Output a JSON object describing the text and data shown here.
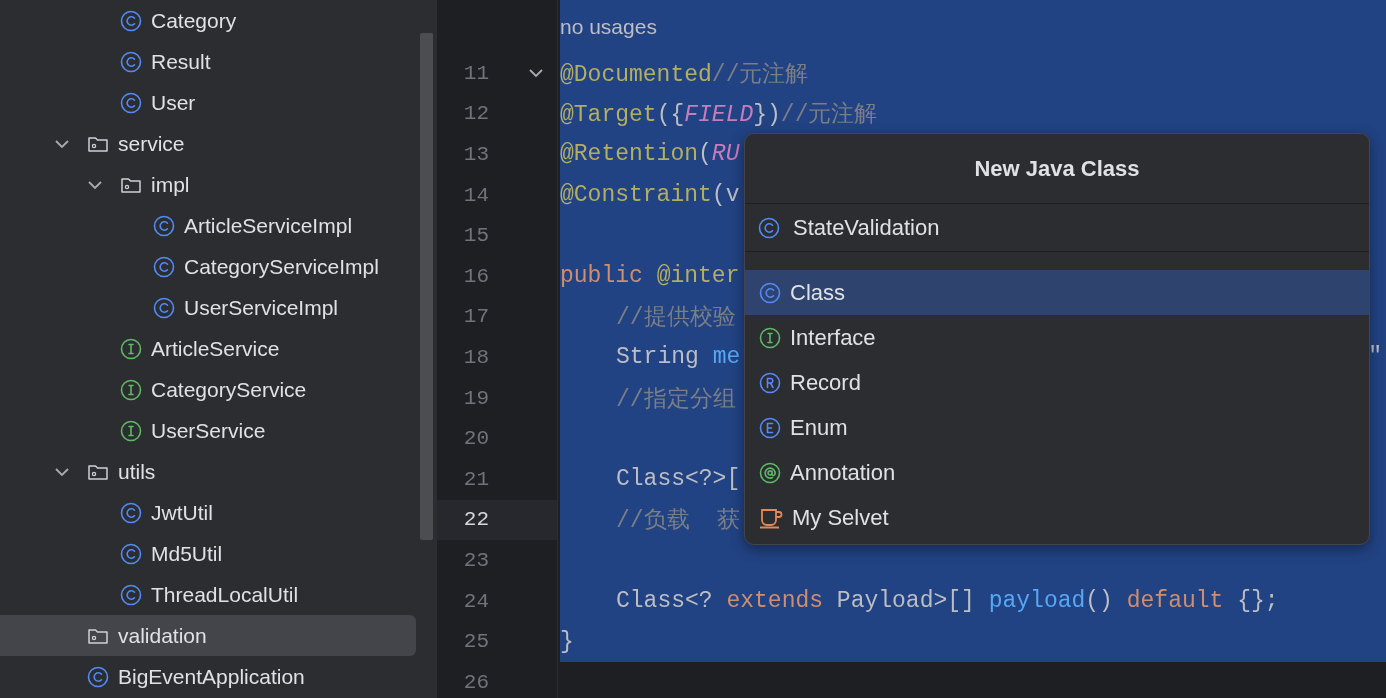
{
  "project_tree": {
    "continued_items": [
      {
        "label": "Category",
        "kind": "class",
        "selected": false
      },
      {
        "label": "Result",
        "kind": "class",
        "selected": false
      },
      {
        "label": "User",
        "kind": "class",
        "selected": false
      }
    ],
    "items": [
      {
        "label": "service",
        "kind": "folder",
        "expanded": true,
        "selected": false,
        "children": [
          {
            "label": "impl",
            "kind": "folder",
            "expanded": true,
            "selected": false,
            "children": [
              {
                "label": "ArticleServiceImpl",
                "kind": "class",
                "selected": false
              },
              {
                "label": "CategoryServiceImpl",
                "kind": "class",
                "selected": false
              },
              {
                "label": "UserServiceImpl",
                "kind": "class",
                "selected": false
              }
            ]
          },
          {
            "label": "ArticleService",
            "kind": "interface",
            "selected": false
          },
          {
            "label": "CategoryService",
            "kind": "interface",
            "selected": false
          },
          {
            "label": "UserService",
            "kind": "interface",
            "selected": false
          }
        ]
      },
      {
        "label": "utils",
        "kind": "folder",
        "expanded": true,
        "selected": false,
        "children": [
          {
            "label": "JwtUtil",
            "kind": "class",
            "selected": false
          },
          {
            "label": "Md5Util",
            "kind": "class",
            "selected": false
          },
          {
            "label": "ThreadLocalUtil",
            "kind": "class",
            "selected": false
          }
        ]
      },
      {
        "label": "validation",
        "kind": "folder",
        "selected": true
      },
      {
        "label": "BigEventApplication",
        "kind": "app",
        "selected": false
      }
    ]
  },
  "editor": {
    "inlay": {
      "text": "no usages",
      "selected": true
    },
    "lines": [
      {
        "number": "11",
        "foldable": true,
        "current": false,
        "selected": true,
        "tokens": [
          {
            "text": "@Documented",
            "kind": "annotation"
          },
          {
            "text": "//元注解",
            "kind": "comment"
          }
        ]
      },
      {
        "number": "12",
        "current": false,
        "selected": true,
        "tokens": [
          {
            "text": "@Target",
            "kind": "annotation"
          },
          {
            "text": "({",
            "kind": "plain"
          },
          {
            "text": "FIELD",
            "kind": "constant"
          },
          {
            "text": "})",
            "kind": "plain"
          },
          {
            "text": "//元注解",
            "kind": "comment"
          }
        ]
      },
      {
        "number": "13",
        "current": false,
        "selected": true,
        "tokens": [
          {
            "text": "@Retention",
            "kind": "annotation"
          },
          {
            "text": "(",
            "kind": "plain"
          },
          {
            "text": "RU",
            "kind": "constant"
          }
        ]
      },
      {
        "number": "14",
        "current": false,
        "selected": true,
        "tokens": [
          {
            "text": "@Constraint",
            "kind": "annotation"
          },
          {
            "text": "(v",
            "kind": "plain"
          }
        ]
      },
      {
        "number": "15",
        "current": false,
        "selected": true
      },
      {
        "number": "16",
        "current": false,
        "selected": true,
        "tokens": [
          {
            "text": "public ",
            "kind": "keyword"
          },
          {
            "text": "@inter",
            "kind": "annotation"
          }
        ]
      },
      {
        "number": "17",
        "current": false,
        "selected": true,
        "indented": true,
        "tokens": [
          {
            "text": "//提供校验",
            "kind": "comment"
          }
        ]
      },
      {
        "number": "18",
        "current": false,
        "selected": true,
        "indented": true,
        "tokens": [
          {
            "text": "String ",
            "kind": "plain"
          },
          {
            "text": "me",
            "kind": "method"
          }
        ],
        "tail": "\""
      },
      {
        "number": "19",
        "current": false,
        "selected": true,
        "indented": true,
        "tokens": [
          {
            "text": "//指定分组",
            "kind": "comment"
          }
        ]
      },
      {
        "number": "20",
        "current": false,
        "selected": true
      },
      {
        "number": "21",
        "current": false,
        "selected": true,
        "indented": true,
        "tokens": [
          {
            "text": "Class<?>[",
            "kind": "plain"
          }
        ]
      },
      {
        "number": "22",
        "current": true,
        "selected": true,
        "indented": true,
        "tokens": [
          {
            "text": "//负载  获",
            "kind": "comment"
          }
        ]
      },
      {
        "number": "23",
        "current": false,
        "selected": true
      },
      {
        "number": "24",
        "current": false,
        "selected": true,
        "indented": true,
        "tokens": [
          {
            "text": "Class<? ",
            "kind": "plain"
          },
          {
            "text": "extends",
            "kind": "keyword"
          },
          {
            "text": " Payload>[] ",
            "kind": "plain"
          },
          {
            "text": "payload",
            "kind": "method"
          },
          {
            "text": "() ",
            "kind": "plain"
          },
          {
            "text": "default",
            "kind": "keyword"
          },
          {
            "text": " {};",
            "kind": "plain"
          }
        ]
      },
      {
        "number": "25",
        "current": false,
        "selected": true,
        "tokens": [
          {
            "text": "}",
            "kind": "plain"
          }
        ]
      },
      {
        "number": "26",
        "current": false,
        "selected": false
      }
    ]
  },
  "new_class_popup": {
    "title": "New Java Class",
    "name_value": "StateValidation",
    "options": [
      {
        "label": "Class",
        "kind": "class",
        "selected": true
      },
      {
        "label": "Interface",
        "kind": "interface",
        "selected": false
      },
      {
        "label": "Record",
        "kind": "record",
        "selected": false
      },
      {
        "label": "Enum",
        "kind": "enum",
        "selected": false
      },
      {
        "label": "Annotation",
        "kind": "annotation",
        "selected": false
      },
      {
        "label": "My Selvet",
        "kind": "servlet",
        "selected": false
      }
    ]
  }
}
